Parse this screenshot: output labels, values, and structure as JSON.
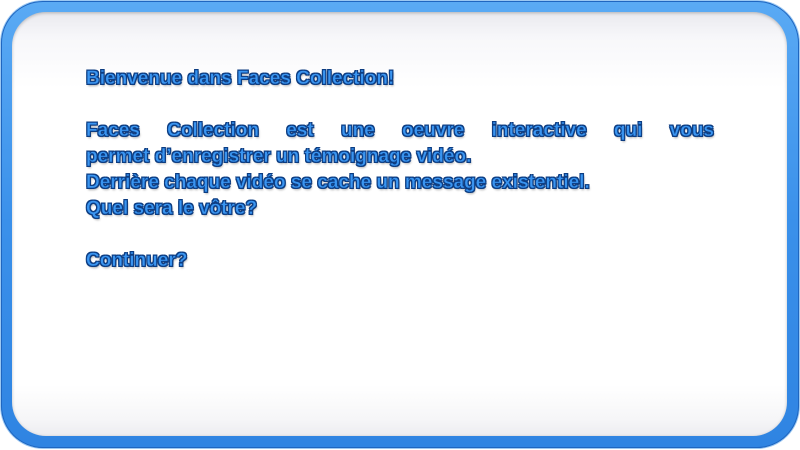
{
  "dialog": {
    "title": "Bienvenue dans Faces Collection!",
    "body_line_1": "Faces Collection est une oeuvre interactive qui vous",
    "body_line_2": "permet d’enregistrer un témoignage vidéo.",
    "body_line_3": "Derrière chaque vidéo se cache un message existentiel.",
    "body_line_4": "Quel sera le vôtre?",
    "continue_label": "Continuer?"
  },
  "colors": {
    "frame": "#3a90ea",
    "text": "#3a95f0",
    "text_outline": "#0e3d80",
    "panel": "#ffffff"
  }
}
